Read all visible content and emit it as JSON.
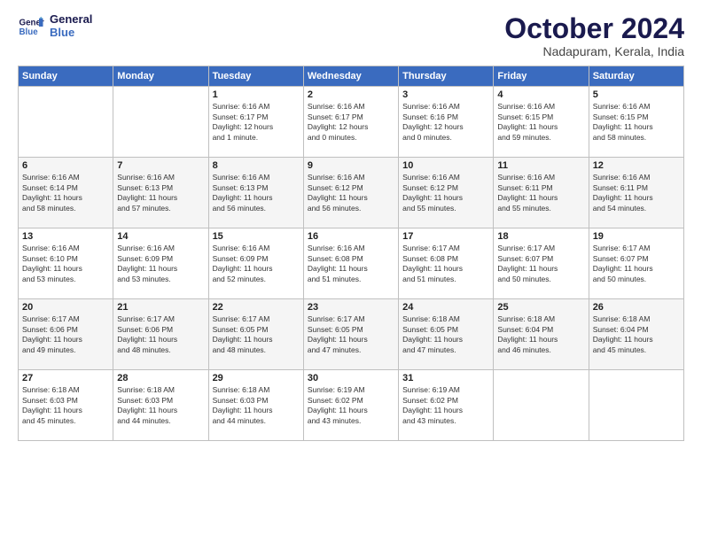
{
  "logo": {
    "line1": "General",
    "line2": "Blue"
  },
  "title": "October 2024",
  "subtitle": "Nadapuram, Kerala, India",
  "days_header": [
    "Sunday",
    "Monday",
    "Tuesday",
    "Wednesday",
    "Thursday",
    "Friday",
    "Saturday"
  ],
  "weeks": [
    [
      {
        "num": "",
        "info": ""
      },
      {
        "num": "",
        "info": ""
      },
      {
        "num": "1",
        "info": "Sunrise: 6:16 AM\nSunset: 6:17 PM\nDaylight: 12 hours\nand 1 minute."
      },
      {
        "num": "2",
        "info": "Sunrise: 6:16 AM\nSunset: 6:17 PM\nDaylight: 12 hours\nand 0 minutes."
      },
      {
        "num": "3",
        "info": "Sunrise: 6:16 AM\nSunset: 6:16 PM\nDaylight: 12 hours\nand 0 minutes."
      },
      {
        "num": "4",
        "info": "Sunrise: 6:16 AM\nSunset: 6:15 PM\nDaylight: 11 hours\nand 59 minutes."
      },
      {
        "num": "5",
        "info": "Sunrise: 6:16 AM\nSunset: 6:15 PM\nDaylight: 11 hours\nand 58 minutes."
      }
    ],
    [
      {
        "num": "6",
        "info": "Sunrise: 6:16 AM\nSunset: 6:14 PM\nDaylight: 11 hours\nand 58 minutes."
      },
      {
        "num": "7",
        "info": "Sunrise: 6:16 AM\nSunset: 6:13 PM\nDaylight: 11 hours\nand 57 minutes."
      },
      {
        "num": "8",
        "info": "Sunrise: 6:16 AM\nSunset: 6:13 PM\nDaylight: 11 hours\nand 56 minutes."
      },
      {
        "num": "9",
        "info": "Sunrise: 6:16 AM\nSunset: 6:12 PM\nDaylight: 11 hours\nand 56 minutes."
      },
      {
        "num": "10",
        "info": "Sunrise: 6:16 AM\nSunset: 6:12 PM\nDaylight: 11 hours\nand 55 minutes."
      },
      {
        "num": "11",
        "info": "Sunrise: 6:16 AM\nSunset: 6:11 PM\nDaylight: 11 hours\nand 55 minutes."
      },
      {
        "num": "12",
        "info": "Sunrise: 6:16 AM\nSunset: 6:11 PM\nDaylight: 11 hours\nand 54 minutes."
      }
    ],
    [
      {
        "num": "13",
        "info": "Sunrise: 6:16 AM\nSunset: 6:10 PM\nDaylight: 11 hours\nand 53 minutes."
      },
      {
        "num": "14",
        "info": "Sunrise: 6:16 AM\nSunset: 6:09 PM\nDaylight: 11 hours\nand 53 minutes."
      },
      {
        "num": "15",
        "info": "Sunrise: 6:16 AM\nSunset: 6:09 PM\nDaylight: 11 hours\nand 52 minutes."
      },
      {
        "num": "16",
        "info": "Sunrise: 6:16 AM\nSunset: 6:08 PM\nDaylight: 11 hours\nand 51 minutes."
      },
      {
        "num": "17",
        "info": "Sunrise: 6:17 AM\nSunset: 6:08 PM\nDaylight: 11 hours\nand 51 minutes."
      },
      {
        "num": "18",
        "info": "Sunrise: 6:17 AM\nSunset: 6:07 PM\nDaylight: 11 hours\nand 50 minutes."
      },
      {
        "num": "19",
        "info": "Sunrise: 6:17 AM\nSunset: 6:07 PM\nDaylight: 11 hours\nand 50 minutes."
      }
    ],
    [
      {
        "num": "20",
        "info": "Sunrise: 6:17 AM\nSunset: 6:06 PM\nDaylight: 11 hours\nand 49 minutes."
      },
      {
        "num": "21",
        "info": "Sunrise: 6:17 AM\nSunset: 6:06 PM\nDaylight: 11 hours\nand 48 minutes."
      },
      {
        "num": "22",
        "info": "Sunrise: 6:17 AM\nSunset: 6:05 PM\nDaylight: 11 hours\nand 48 minutes."
      },
      {
        "num": "23",
        "info": "Sunrise: 6:17 AM\nSunset: 6:05 PM\nDaylight: 11 hours\nand 47 minutes."
      },
      {
        "num": "24",
        "info": "Sunrise: 6:18 AM\nSunset: 6:05 PM\nDaylight: 11 hours\nand 47 minutes."
      },
      {
        "num": "25",
        "info": "Sunrise: 6:18 AM\nSunset: 6:04 PM\nDaylight: 11 hours\nand 46 minutes."
      },
      {
        "num": "26",
        "info": "Sunrise: 6:18 AM\nSunset: 6:04 PM\nDaylight: 11 hours\nand 45 minutes."
      }
    ],
    [
      {
        "num": "27",
        "info": "Sunrise: 6:18 AM\nSunset: 6:03 PM\nDaylight: 11 hours\nand 45 minutes."
      },
      {
        "num": "28",
        "info": "Sunrise: 6:18 AM\nSunset: 6:03 PM\nDaylight: 11 hours\nand 44 minutes."
      },
      {
        "num": "29",
        "info": "Sunrise: 6:18 AM\nSunset: 6:03 PM\nDaylight: 11 hours\nand 44 minutes."
      },
      {
        "num": "30",
        "info": "Sunrise: 6:19 AM\nSunset: 6:02 PM\nDaylight: 11 hours\nand 43 minutes."
      },
      {
        "num": "31",
        "info": "Sunrise: 6:19 AM\nSunset: 6:02 PM\nDaylight: 11 hours\nand 43 minutes."
      },
      {
        "num": "",
        "info": ""
      },
      {
        "num": "",
        "info": ""
      }
    ]
  ]
}
